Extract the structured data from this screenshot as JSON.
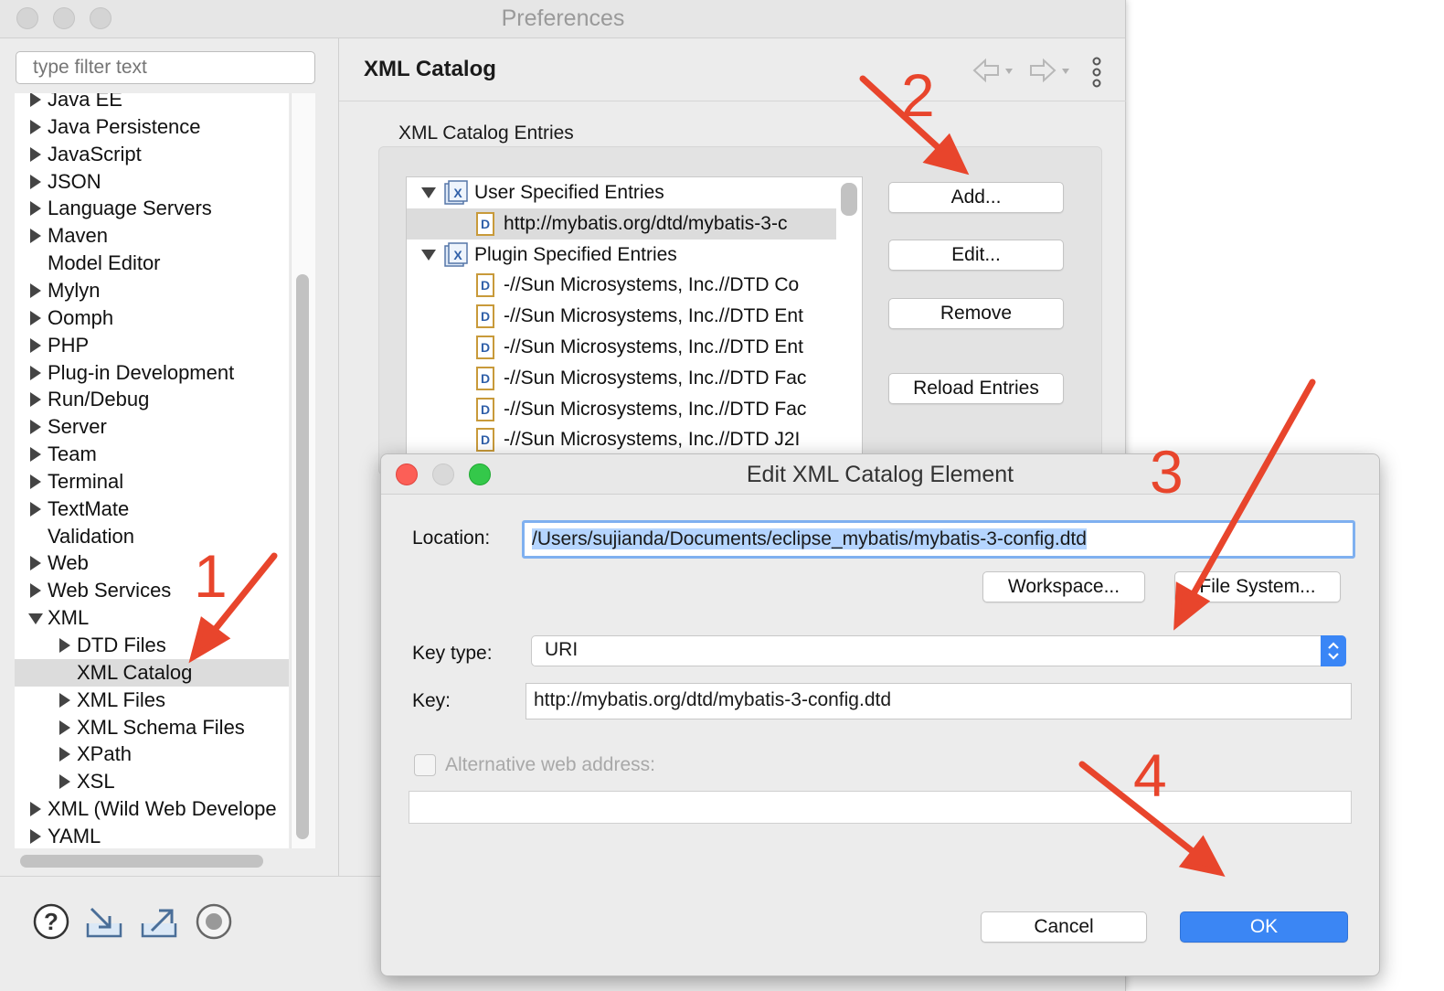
{
  "window": {
    "title": "Preferences"
  },
  "filter": {
    "placeholder": "type filter text"
  },
  "tree": [
    {
      "label": "Java EE",
      "arrow": "right",
      "indent": 0
    },
    {
      "label": "Java Persistence",
      "arrow": "right",
      "indent": 0
    },
    {
      "label": "JavaScript",
      "arrow": "right",
      "indent": 0
    },
    {
      "label": "JSON",
      "arrow": "right",
      "indent": 0
    },
    {
      "label": "Language Servers",
      "arrow": "right",
      "indent": 0
    },
    {
      "label": "Maven",
      "arrow": "right",
      "indent": 0
    },
    {
      "label": "Model Editor",
      "arrow": "none",
      "indent": 0
    },
    {
      "label": "Mylyn",
      "arrow": "right",
      "indent": 0
    },
    {
      "label": "Oomph",
      "arrow": "right",
      "indent": 0
    },
    {
      "label": "PHP",
      "arrow": "right",
      "indent": 0
    },
    {
      "label": "Plug-in Development",
      "arrow": "right",
      "indent": 0
    },
    {
      "label": "Run/Debug",
      "arrow": "right",
      "indent": 0
    },
    {
      "label": "Server",
      "arrow": "right",
      "indent": 0
    },
    {
      "label": "Team",
      "arrow": "right",
      "indent": 0
    },
    {
      "label": "Terminal",
      "arrow": "right",
      "indent": 0
    },
    {
      "label": "TextMate",
      "arrow": "right",
      "indent": 0
    },
    {
      "label": "Validation",
      "arrow": "none",
      "indent": 0
    },
    {
      "label": "Web",
      "arrow": "right",
      "indent": 0
    },
    {
      "label": "Web Services",
      "arrow": "right",
      "indent": 0
    },
    {
      "label": "XML",
      "arrow": "down",
      "indent": 0
    },
    {
      "label": "DTD Files",
      "arrow": "right",
      "indent": 1
    },
    {
      "label": "XML Catalog",
      "arrow": "none",
      "indent": 1,
      "selected": true
    },
    {
      "label": "XML Files",
      "arrow": "right",
      "indent": 1
    },
    {
      "label": "XML Schema Files",
      "arrow": "right",
      "indent": 1
    },
    {
      "label": "XPath",
      "arrow": "right",
      "indent": 1
    },
    {
      "label": "XSL",
      "arrow": "right",
      "indent": 1
    },
    {
      "label": "XML (Wild Web Develope",
      "arrow": "right",
      "indent": 0
    },
    {
      "label": "YAML",
      "arrow": "right",
      "indent": 0
    }
  ],
  "page": {
    "title": "XML Catalog",
    "entries_label": "XML Catalog Entries"
  },
  "catalog": [
    {
      "label": "User Specified Entries",
      "type": "group"
    },
    {
      "label": "http://mybatis.org/dtd/mybatis-3-c",
      "type": "entry",
      "selected": true
    },
    {
      "label": "Plugin Specified Entries",
      "type": "group"
    },
    {
      "label": "-//Sun Microsystems, Inc.//DTD Co",
      "type": "entry"
    },
    {
      "label": "-//Sun Microsystems, Inc.//DTD Ent",
      "type": "entry"
    },
    {
      "label": "-//Sun Microsystems, Inc.//DTD Ent",
      "type": "entry"
    },
    {
      "label": "-//Sun Microsystems, Inc.//DTD Fac",
      "type": "entry"
    },
    {
      "label": "-//Sun Microsystems, Inc.//DTD Fac",
      "type": "entry"
    },
    {
      "label": "-//Sun Microsystems, Inc.//DTD J2I",
      "type": "entry"
    }
  ],
  "buttons": {
    "add": "Add...",
    "edit": "Edit...",
    "remove": "Remove",
    "reload": "Reload Entries"
  },
  "dialog": {
    "title": "Edit XML Catalog Element",
    "location_label": "Location:",
    "location_value": "/Users/sujianda/Documents/eclipse_mybatis/mybatis-3-config.dtd",
    "workspace_button": "Workspace...",
    "filesystem_button": "File System...",
    "key_type_label": "Key type:",
    "key_type_value": "URI",
    "key_label": "Key:",
    "key_value": "http://mybatis.org/dtd/mybatis-3-config.dtd",
    "alt_label": "Alternative web address:",
    "alt_value": "",
    "cancel_button": "Cancel",
    "ok_button": "OK"
  },
  "annotations": {
    "step1": "1",
    "step2": "2",
    "step3": "3",
    "step4": "4"
  },
  "colors": {
    "annotation": "#e8452c",
    "accent": "#3b86f4",
    "selection": "#dcdcdc"
  }
}
